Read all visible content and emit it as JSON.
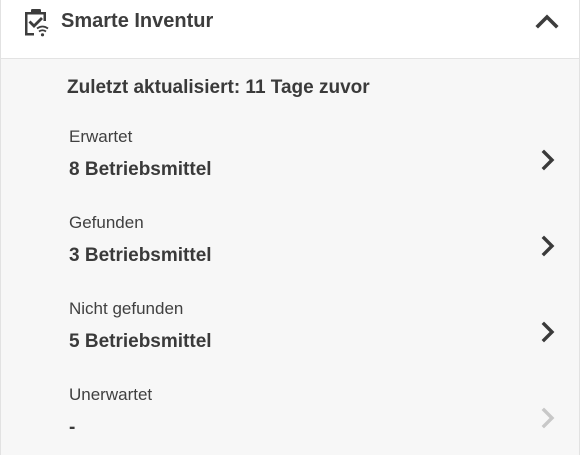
{
  "header": {
    "title": "Smarte Inventur",
    "icon": "clipboard-check-wifi-icon",
    "toggle_icon": "chevron-up-icon"
  },
  "summary": {
    "last_updated": "Zuletzt aktualisiert: 11 Tage zuvor"
  },
  "rows": [
    {
      "label": "Erwartet",
      "value": "8 Betriebsmittel",
      "enabled": true
    },
    {
      "label": "Gefunden",
      "value": "3 Betriebsmittel",
      "enabled": true
    },
    {
      "label": "Nicht gefunden",
      "value": "5 Betriebsmittel",
      "enabled": true
    },
    {
      "label": "Unerwartet",
      "value": "-",
      "enabled": false
    }
  ],
  "colors": {
    "text": "#3a3a3a",
    "chevron_active": "#3a3a3a",
    "chevron_disabled": "#c8c8c8",
    "panel_bg": "#f7f7f7",
    "header_bg": "#ffffff"
  }
}
